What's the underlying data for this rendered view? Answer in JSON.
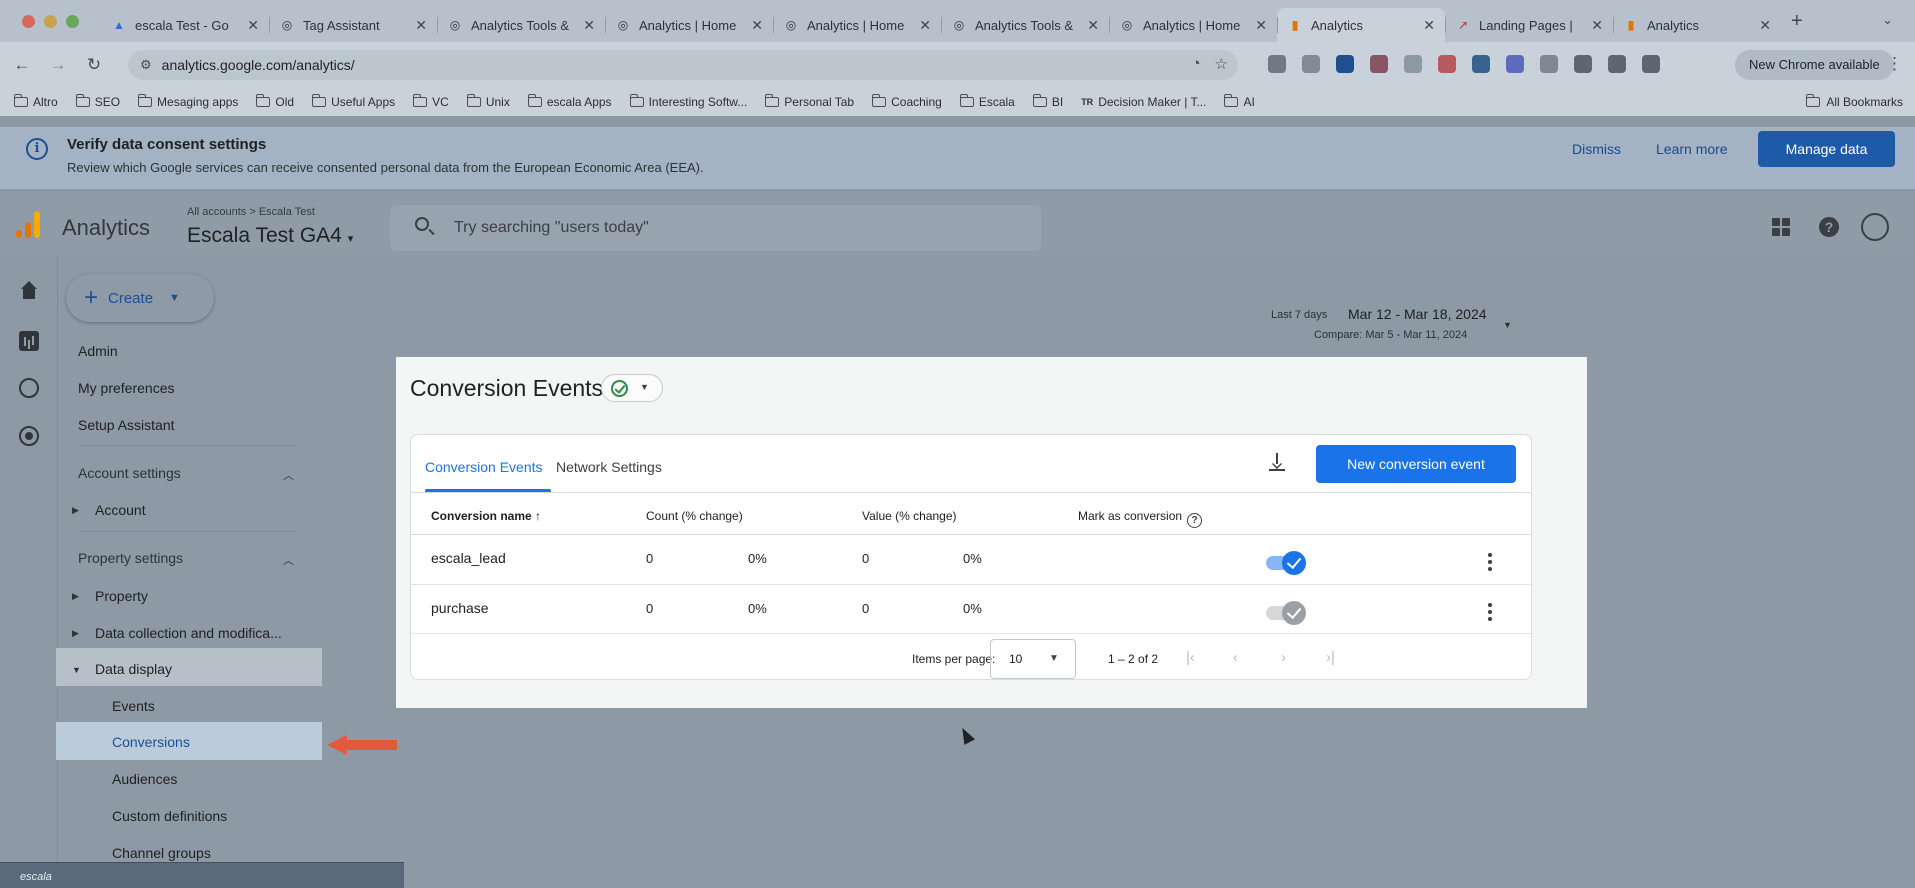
{
  "browser": {
    "tabs": [
      {
        "title": "escala Test - Go",
        "favicon": "google-ads-icon",
        "active": false
      },
      {
        "title": "Tag Assistant",
        "favicon": "tag-assistant-icon",
        "active": false
      },
      {
        "title": "Analytics Tools &",
        "favicon": "analytics-tools-icon",
        "active": false
      },
      {
        "title": "Analytics | Home",
        "favicon": "analytics-tools-icon",
        "active": false
      },
      {
        "title": "Analytics | Home",
        "favicon": "analytics-tools-icon",
        "active": false
      },
      {
        "title": "Analytics Tools &",
        "favicon": "analytics-tools-icon",
        "active": false
      },
      {
        "title": "Analytics | Home",
        "favicon": "analytics-tools-icon",
        "active": false
      },
      {
        "title": "Analytics",
        "favicon": "google-analytics-icon",
        "active": true
      },
      {
        "title": "Landing Pages |",
        "favicon": "landing-pages-icon",
        "active": false
      },
      {
        "title": "Analytics",
        "favicon": "google-analytics-icon",
        "active": false
      }
    ],
    "url": "analytics.google.com/analytics/",
    "new_chrome_label": "New Chrome available",
    "bookmarks": [
      "Altro",
      "SEO",
      "Mesaging apps",
      "Old",
      "Useful Apps",
      "VC",
      "Unix",
      "escala Apps",
      "Interesting Softw...",
      "Personal Tab",
      "Coaching",
      "Escala",
      "BI",
      "Decision Maker | T...",
      "AI"
    ],
    "all_bookmarks": "All Bookmarks"
  },
  "banner": {
    "title": "Verify data consent settings",
    "text": "Review which Google services can receive consented personal data from the European Economic Area (EEA).",
    "dismiss": "Dismiss",
    "learn_more": "Learn more",
    "manage": "Manage data"
  },
  "header": {
    "product": "Analytics",
    "breadcrumb": "All accounts > Escala Test",
    "property": "Escala Test GA4",
    "search_placeholder": "Try searching \"users today\""
  },
  "sidebar": {
    "create": "Create",
    "top_items": [
      "Admin",
      "My preferences",
      "Setup Assistant"
    ],
    "account_settings": "Account settings",
    "account": "Account",
    "property_settings": "Property settings",
    "property": "Property",
    "data_collection": "Data collection and modifica...",
    "data_display": "Data display",
    "sub_items": [
      "Events",
      "Conversions",
      "Audiences",
      "Custom definitions",
      "Channel groups"
    ],
    "active_item": "Conversions"
  },
  "date": {
    "label": "Last 7 days",
    "range": "Mar 12 - Mar 18, 2024",
    "compare": "Compare: Mar 5 - Mar 11, 2024"
  },
  "card": {
    "title": "Conversion Events",
    "tabs": [
      "Conversion Events",
      "Network Settings"
    ],
    "new_button": "New conversion event",
    "columns": [
      "Conversion name",
      "Count (% change)",
      "Value (% change)",
      "Mark as conversion"
    ],
    "sort_indicator": "↑",
    "rows": [
      {
        "name": "escala_lead",
        "count": "0",
        "count_change": "0%",
        "value": "0",
        "value_change": "0%",
        "marked": true
      },
      {
        "name": "purchase",
        "count": "0",
        "count_change": "0%",
        "value": "0",
        "value_change": "0%",
        "marked": true
      }
    ],
    "items_per_page_label": "Items per page:",
    "items_per_page": "10",
    "page_range": "1 – 2 of 2"
  },
  "colors": {
    "accent": "#1a73e8",
    "annotation_arrow": "#e25a3c",
    "overlay": "#8d9aa5"
  },
  "dock_thumbnail_text": "escala"
}
